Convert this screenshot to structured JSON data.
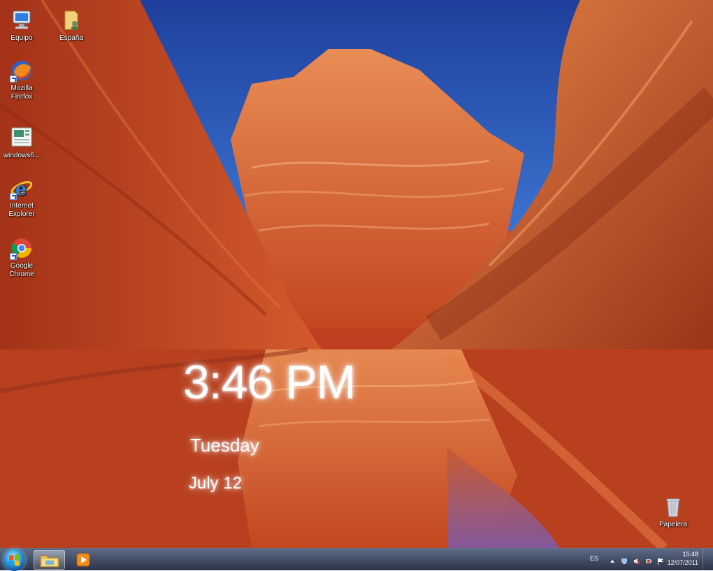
{
  "desktop": {
    "icons": [
      {
        "label": "Equipo",
        "icon": "computer-icon"
      },
      {
        "label": "España",
        "icon": "user-folder-icon"
      },
      {
        "label": "Mozilla Firefox",
        "line1": "Mozilla",
        "line2": "Firefox",
        "icon": "firefox-icon"
      },
      {
        "label": "windows6...",
        "icon": "document-icon"
      },
      {
        "label": "Internet Explorer",
        "line1": "Internet",
        "line2": "Explorer",
        "icon": "internet-explorer-icon"
      },
      {
        "label": "Google Chrome",
        "line1": "Google",
        "line2": "Chrome",
        "icon": "chrome-icon"
      },
      {
        "label": "Papelera",
        "icon": "recycle-bin-icon"
      }
    ]
  },
  "clock_gadget": {
    "time": "3:46 PM",
    "day": "Tuesday",
    "date": "July 12"
  },
  "taskbar": {
    "pinned": [
      {
        "name": "Windows Explorer",
        "icon": "folder-icon",
        "active": true
      },
      {
        "name": "Windows Media Player",
        "icon": "media-player-icon",
        "active": false
      }
    ],
    "tray": {
      "language": "ES",
      "time": "15:48",
      "date": "12/07/2011"
    }
  },
  "colors": {
    "sky": "#2d63c2",
    "rock": "#c9502b",
    "taskbar": "#3a4560"
  }
}
